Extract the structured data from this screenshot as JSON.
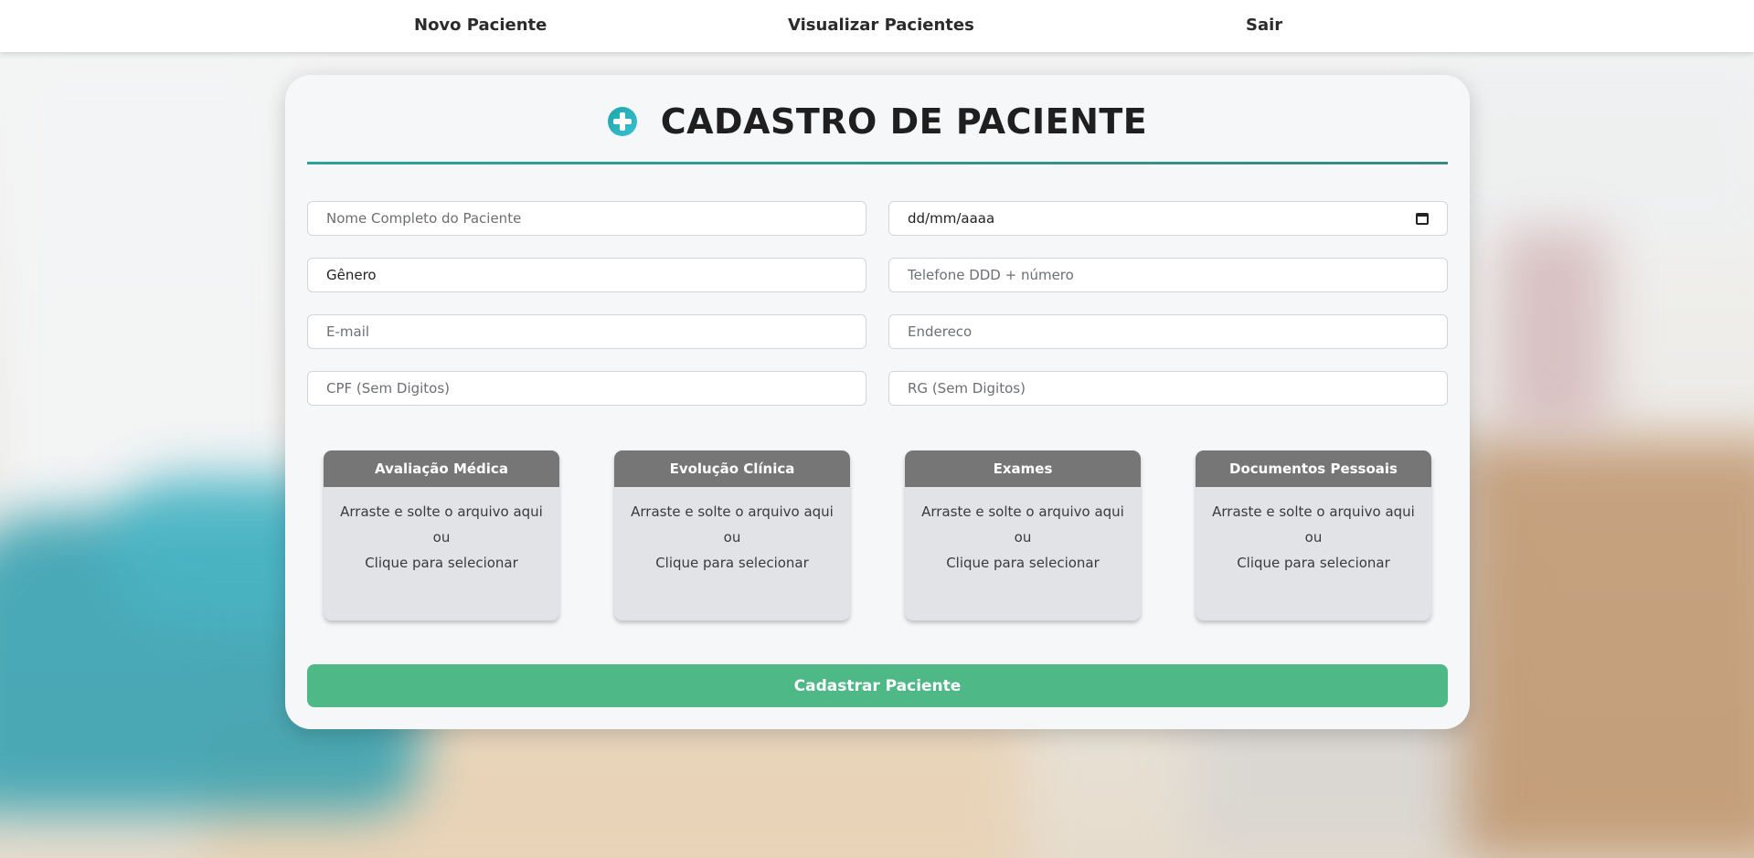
{
  "nav": {
    "items": [
      {
        "label": "Novo Paciente"
      },
      {
        "label": "Visualizar Pacientes"
      },
      {
        "label": "Sair"
      }
    ]
  },
  "form": {
    "title": "CADASTRO DE PACIENTE",
    "title_icon": "plus-circle-icon",
    "fields": {
      "nome": {
        "placeholder": "Nome Completo do Paciente",
        "value": ""
      },
      "data_nascimento": {
        "value": "dd/mm/aaaa",
        "icon": "calendar-icon"
      },
      "genero": {
        "value": "Gênero"
      },
      "telefone": {
        "placeholder": "Telefone DDD + número",
        "value": ""
      },
      "email": {
        "placeholder": "E-mail",
        "value": ""
      },
      "endereco": {
        "placeholder": "Endereco",
        "value": ""
      },
      "cpf": {
        "placeholder": "CPF (Sem Digitos)",
        "value": ""
      },
      "rg": {
        "placeholder": "RG (Sem Digitos)",
        "value": ""
      }
    },
    "uploads": [
      {
        "title": "Avaliação Médica",
        "line1": "Arraste e solte o arquivo aqui",
        "line2": "ou",
        "line3": "Clique para selecionar"
      },
      {
        "title": "Evolução Clínica",
        "line1": "Arraste e solte o arquivo aqui",
        "line2": "ou",
        "line3": "Clique para selecionar"
      },
      {
        "title": "Exames",
        "line1": "Arraste e solte o arquivo aqui",
        "line2": "ou",
        "line3": "Clique para selecionar"
      },
      {
        "title": "Documentos Pessoais",
        "line1": "Arraste e solte o arquivo aqui",
        "line2": "ou",
        "line3": "Clique para selecionar"
      }
    ],
    "submit_label": "Cadastrar Paciente"
  },
  "colors": {
    "accent_teal": "#2aa39a",
    "submit_green": "#4fb887",
    "upload_header_gray": "#767676",
    "card_bg": "#f6f7f9"
  }
}
